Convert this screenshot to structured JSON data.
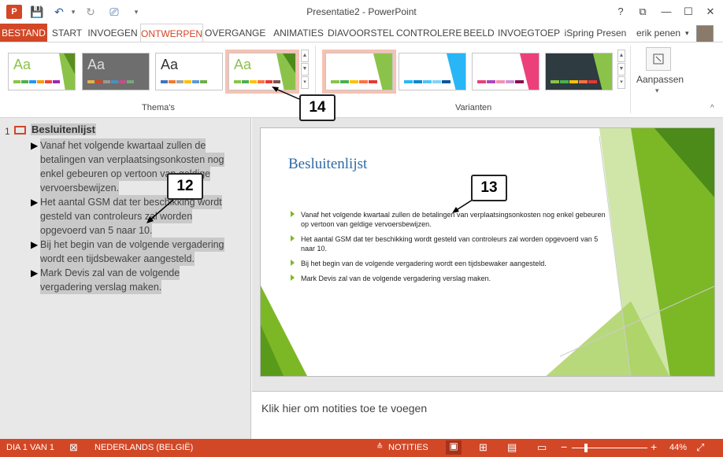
{
  "app": {
    "title": "Presentatie2 - PowerPoint"
  },
  "qa": {
    "logo": "P",
    "save": "💾",
    "undo": "↶",
    "undo_dd": "▾",
    "redo": "↻",
    "present": "⎚",
    "more": "▾"
  },
  "window": {
    "help": "?",
    "restore": "⧉",
    "minimize": "—",
    "maximize": "☐",
    "close": "✕"
  },
  "tabs": [
    {
      "label": "BESTAND"
    },
    {
      "label": "START"
    },
    {
      "label": "INVOEGEN"
    },
    {
      "label": "ONTWERPEN"
    },
    {
      "label": "OVERGANGE"
    },
    {
      "label": "ANIMATIES"
    },
    {
      "label": "DIAVOORSTEL"
    },
    {
      "label": "CONTROLERE"
    },
    {
      "label": "BEELD"
    },
    {
      "label": "INVOEGTOEP"
    },
    {
      "label": "iSpring Presen"
    }
  ],
  "user": {
    "name": "erik penen",
    "dd": "▾"
  },
  "ribbon": {
    "themes_label": "Thema's",
    "variants_label": "Varianten",
    "customize_label": "Aanpassen",
    "customize_dd": "▾",
    "collapse": "^",
    "theme_aa": "Aa"
  },
  "callouts": {
    "c12": "12",
    "c13": "13",
    "c14": "14"
  },
  "outline": {
    "slide_num": "1",
    "title": "Besluitenlijst",
    "bullets": [
      {
        "lines": [
          "Vanaf het volgende kwartaal zullen de",
          "betalingen van verplaatsingsonkosten nog",
          "enkel gebeuren op vertoon van geldige",
          "vervoersbewijzen."
        ]
      },
      {
        "lines": [
          "Het aantal GSM dat ter beschikking wordt",
          "gesteld van controleurs zal worden",
          "opgevoerd van 5 naar 10."
        ]
      },
      {
        "lines": [
          "Bij het begin van de volgende vergadering",
          "wordt een tijdsbewaker aangesteld."
        ]
      },
      {
        "lines": [
          "Mark Devis zal van de volgende",
          "vergadering verslag maken."
        ]
      }
    ]
  },
  "slide": {
    "title": "Besluitenlijst",
    "items": [
      "Vanaf het volgende kwartaal zullen de betalingen van verplaatsingsonkosten nog enkel gebeuren op vertoon van geldige vervoersbewijzen.",
      "Het aantal GSM dat ter beschikking wordt gesteld van controleurs zal worden opgevoerd van 5 naar 10.",
      "Bij het begin van de volgende vergadering wordt een tijdsbewaker aangesteld.",
      "Mark Devis zal van de volgende vergadering verslag maken."
    ]
  },
  "notes": {
    "placeholder": "Klik hier om notities toe te voegen"
  },
  "status": {
    "slide": "DIA 1 VAN 1",
    "language": "NEDERLANDS (BELGIË)",
    "notes": "NOTITIES",
    "zoom": "44%",
    "zoom_minus": "−",
    "zoom_plus": "+"
  },
  "colors": {
    "accent": "#d24726",
    "slide_green": "#7cb826",
    "title_blue": "#2c6aa6"
  }
}
